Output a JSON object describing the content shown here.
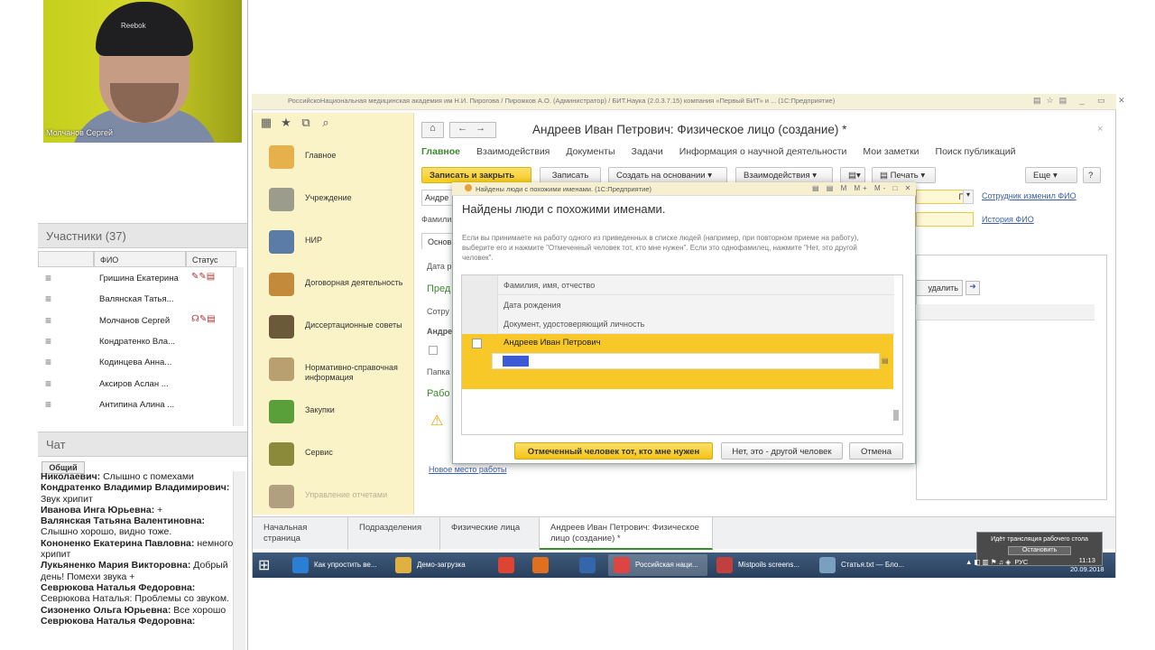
{
  "video": {
    "participant_name": "Молчанов Сергей",
    "cap_text": "Reebok"
  },
  "participants": {
    "header": "Участники (37)",
    "columns": {
      "name": "ФИО",
      "status": "Статус"
    },
    "rows": [
      {
        "name": "Гришина Екатерина",
        "status": "✎✎▤"
      },
      {
        "name": "Валянская Татья...",
        "status": ""
      },
      {
        "name": "Молчанов Сергей",
        "status": "☊✎▤"
      },
      {
        "name": "Кондратенко Вла...",
        "status": ""
      },
      {
        "name": "Кодинцева Анна...",
        "status": ""
      },
      {
        "name": "Аксиров Аслан ...",
        "status": ""
      },
      {
        "name": "Антипина Алина ...",
        "status": ""
      }
    ]
  },
  "chat": {
    "header": "Чат",
    "tab": "Общий",
    "messages": [
      {
        "author": "Николаевич:",
        "text": "Слышно с помехами"
      },
      {
        "author": "Кондратенко Владимир Владимирович:",
        "text": "Звук хрипит"
      },
      {
        "author": "Иванова Инга Юрьевна:",
        "text": "+"
      },
      {
        "author": "Валянская Татьяна Валентиновна:",
        "text": "Слышно хорошо, видно тоже."
      },
      {
        "author": "Кононенко Екатерина Павловна:",
        "text": "немного хрипит"
      },
      {
        "author": "Лукьяненко Мария Викторовна:",
        "text": "Добрый день! Помехи звука +"
      },
      {
        "author": "Севрюкова Наталья Федоровна:",
        "text": "Севрюкова Наталья: Проблемы со звуком."
      },
      {
        "author": "Сизоненко Ольга Юрьевна:",
        "text": "Все хорошо"
      },
      {
        "author": "Севрюкова Наталья Федоровна:",
        "text": ""
      }
    ]
  },
  "app": {
    "titlebar": "РоссийскоНациональная медицинская академия им Н.И. Пирогова / Пирожков А.О. (Администратор) / БИТ.Наука (2.0.3.7.15) компания «Первый БИТ» и ...  (1С:Предприятие)",
    "sidebar": [
      {
        "label": "Главное",
        "icon": "main-icon",
        "color": "#e6b04a"
      },
      {
        "label": "Учреждение",
        "icon": "building-icon",
        "color": "#9c9c8c"
      },
      {
        "label": "НИР",
        "icon": "books-icon",
        "color": "#5c7ca8"
      },
      {
        "label": "Договорная деятельность",
        "icon": "contract-icon",
        "color": "#c28a3a"
      },
      {
        "label": "Диссертационные советы",
        "icon": "graduate-icon",
        "color": "#6a5a3a"
      },
      {
        "label": "Нормативно-справочная информация",
        "icon": "reference-icon",
        "color": "#b8a070"
      },
      {
        "label": "Закупки",
        "icon": "purchases-icon",
        "color": "#5aa03a"
      },
      {
        "label": "Сервис",
        "icon": "service-icon",
        "color": "#8a8a3a"
      },
      {
        "label": "Управление отчетами",
        "icon": "reports-icon",
        "color": "#b0a080"
      }
    ],
    "form_title": "Андреев Иван Петрович: Физическое лицо (создание) *",
    "tabs": [
      "Главное",
      "Взаимодействия",
      "Документы",
      "Задачи",
      "Информация о научной деятельности",
      "Мои заметки",
      "Поиск публикаций"
    ],
    "toolbar": {
      "save_close": "Записать и закрыть",
      "save": "Записать",
      "create_based": "Создать на основании",
      "interactions": "Взаимодействия",
      "print": "Печать",
      "more": "Еще",
      "help": "?"
    },
    "form": {
      "field_prefix": "Андре",
      "family_label": "Фамилия",
      "tab_main": "Основ",
      "birth_label": "Дата р",
      "section_pred": "Пред",
      "employee_label": "Сотру",
      "andre2": "Андре",
      "folder_label": "Папка",
      "work_label": "Рабо",
      "link_changed": "Сотрудник изменил ФИО",
      "link_history": "История ФИО",
      "field_value": "П",
      "delete_btn": "удалить",
      "new_workplace": "Новое место работы"
    },
    "bottom_tabs": [
      "Начальная страница",
      "Подразделения",
      "Физические лица",
      "Андреев Иван Петрович: Физическое лицо (создание) *"
    ]
  },
  "dialog": {
    "title": "Найдены люди с похожими именами. (1С:Предприятие)",
    "controls": "▤ ▤ M M+ M- □ ✕",
    "heading": "Найдены люди с похожими именами.",
    "description": "Если вы принимаете на работу одного из приведенных в списке людей (например, при повторном приеме на работу), выберите его и нажмите \"Отмеченный человек тот, кто мне нужен\". Если это однофамилец, нажмите \"Нет, это другой человек\".",
    "columns": [
      "Фамилия, имя, отчество",
      "Дата рождения",
      "Документ, удостоверяющий личность"
    ],
    "row_name": "Андреев Иван Петрович",
    "btn_confirm": "Отмеченный человек тот, кто мне нужен",
    "btn_other": "Нет, это - другой человек",
    "btn_cancel": "Отмена"
  },
  "taskbar": {
    "items": [
      {
        "label": "Как упростить ве...",
        "color": "#2a7fd4"
      },
      {
        "label": "Демо-загрузка",
        "color": "#e0b040"
      },
      {
        "label": "",
        "color": "#dd4433"
      },
      {
        "label": "",
        "color": "#e07020"
      },
      {
        "label": "",
        "color": "#3366aa"
      },
      {
        "label": "Российская наци...",
        "color": "#d44"
      },
      {
        "label": "Mistpoils screens...",
        "color": "#c04040"
      },
      {
        "label": "Статья.txt — Бло...",
        "color": "#7aa0c0"
      }
    ],
    "lang": "РУС",
    "time": "11:13",
    "date": "20.09.2018",
    "notif_title": "Идёт трансляция рабочего стола",
    "notif_btn": "Остановить"
  }
}
